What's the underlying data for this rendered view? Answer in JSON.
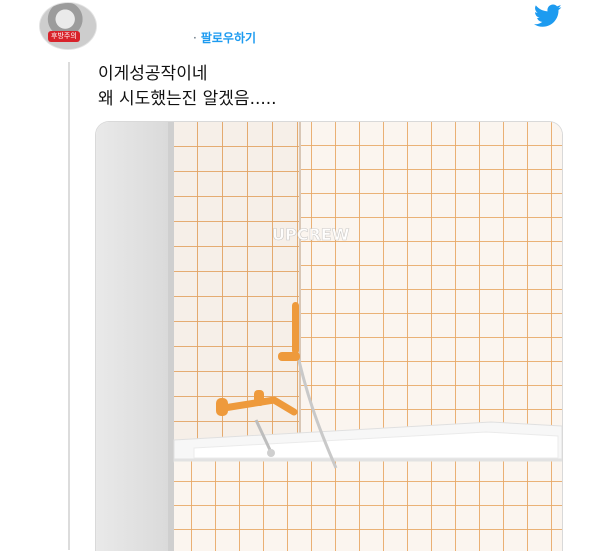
{
  "avatar": {
    "badge_text": "후방주의"
  },
  "header": {
    "separator": "·",
    "follow_label": "팔로우하기"
  },
  "tweet": {
    "lines": [
      "이게성공작이네",
      "왜 시도했는진 알겠음....."
    ]
  },
  "media": {
    "watermark": "UPCREW",
    "description_icon": "bathroom-photo"
  },
  "colors": {
    "twitter_blue": "#1d9bf0",
    "grout_orange": "#e6a565",
    "faucet_orange": "#ee9a3c"
  }
}
